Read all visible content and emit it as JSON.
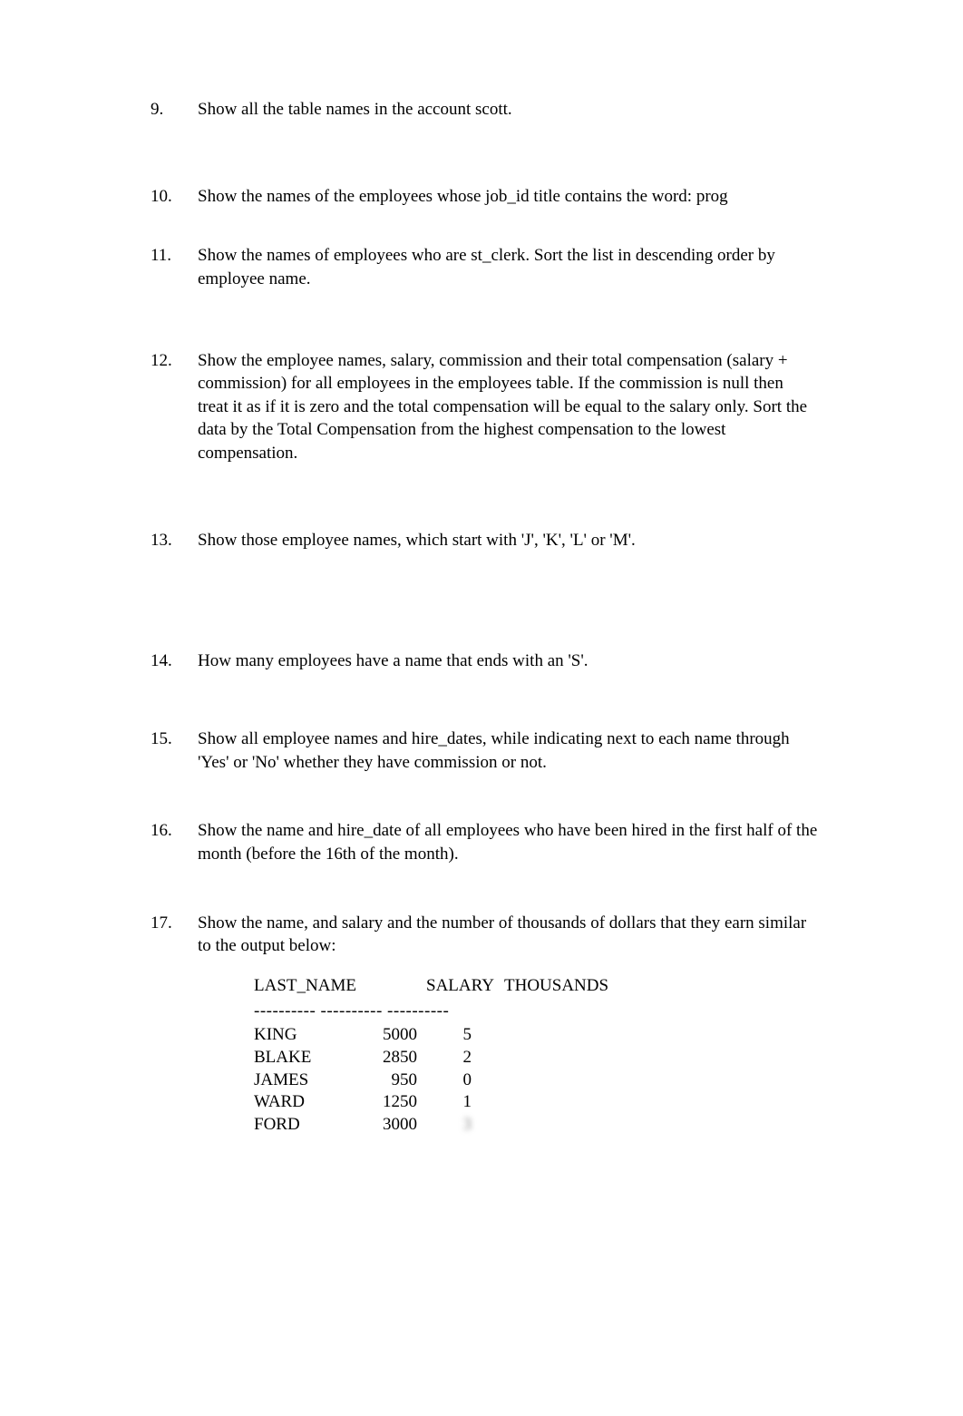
{
  "questions": {
    "q9": {
      "num": "9.",
      "text": "Show all the table names in the account scott."
    },
    "q10": {
      "num": "10.",
      "text": "Show the names of the employees whose job_id title contains the word: prog"
    },
    "q11": {
      "num": "11.",
      "text": "Show the names of employees who are st_clerk.  Sort the list in descending order by employee name."
    },
    "q12": {
      "num": "12.",
      "text": "Show the employee names, salary, commission and their total compensation (salary + commission) for all employees in the employees table.  If the commission is null then treat it as if it is zero and the total compensation will be equal to the salary only.  Sort the data by the Total Compensation from the highest compensation to the lowest compensation."
    },
    "q13": {
      "num": "13.",
      "text": "Show those employee names, which start with 'J', 'K', 'L' or 'M'."
    },
    "q14": {
      "num": "14.",
      "text": "How many employees have a name that ends with an 'S'."
    },
    "q15": {
      "num": "15.",
      "text": "Show all employee names and hire_dates, while indicating next to each name through 'Yes' or 'No' whether they have commission or not."
    },
    "q16": {
      "num": "16.",
      "text": "Show the name and hire_date of all employees who have been hired in the first half of the month (before the 16th of the month)."
    },
    "q17": {
      "num": "17.",
      "text": "Show the name, and salary and the number of thousands of dollars that they earn similar to the output below:"
    }
  },
  "output": {
    "header": {
      "name": "LAST_NAME",
      "salary": "SALARY",
      "thousands": "THOUSANDS"
    },
    "dashes": "---------- ---------- ----------",
    "rows": [
      {
        "name": "KING",
        "salary": "5000",
        "thousands": "5"
      },
      {
        "name": "BLAKE",
        "salary": "2850",
        "thousands": "2"
      },
      {
        "name": "JAMES",
        "salary": "950",
        "thousands": "0"
      },
      {
        "name": "WARD",
        "salary": "1250",
        "thousands": "1"
      },
      {
        "name": "FORD",
        "salary": "3000",
        "thousands": "3"
      }
    ]
  }
}
